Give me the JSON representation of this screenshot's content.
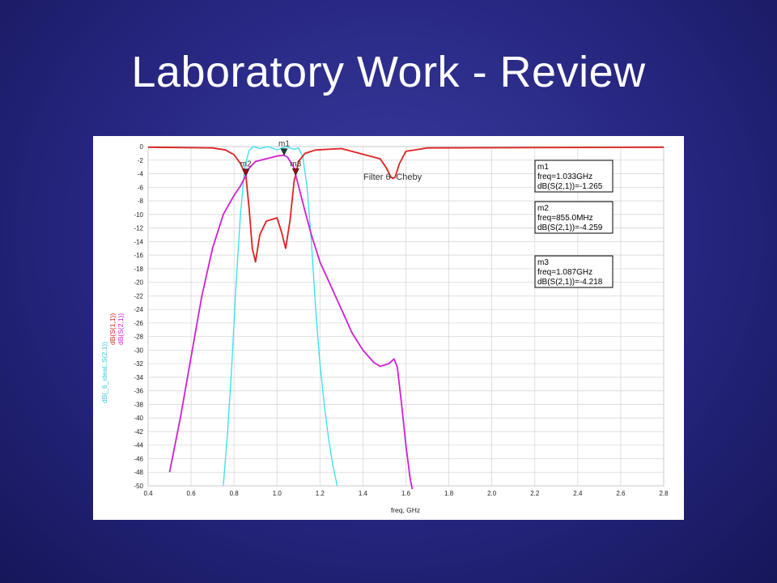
{
  "slide": {
    "title": "Laboratory Work - Review"
  },
  "chart_data": {
    "type": "line",
    "xlabel": "freq, GHz",
    "xlim": [
      0.4,
      2.8
    ],
    "ylim": [
      -50,
      0
    ],
    "xticks": [
      "0.4",
      "0.6",
      "0.8",
      "1.0",
      "1.2",
      "1.4",
      "1.6",
      "1.8",
      "2.0",
      "2.2",
      "2.4",
      "2.6",
      "2.8"
    ],
    "yticks": [
      "0",
      "-2",
      "-4",
      "-6",
      "-8",
      "-10",
      "-12",
      "-14",
      "-16",
      "-18",
      "-20",
      "-22",
      "-24",
      "-26",
      "-28",
      "-30",
      "-32",
      "-34",
      "-36",
      "-38",
      "-40",
      "-42",
      "-44",
      "-46",
      "-48",
      "-50"
    ],
    "annotation": "Filter 6- Cheby",
    "series": [
      {
        "name": "dB(_6_ideal..S(2,1))",
        "color": "#33e0f0",
        "x": [
          0.75,
          0.77,
          0.79,
          0.81,
          0.83,
          0.85,
          0.87,
          0.89,
          0.92,
          0.96,
          1.0,
          1.04,
          1.08,
          1.1,
          1.12,
          1.14,
          1.16,
          1.18,
          1.2,
          1.22,
          1.24,
          1.26,
          1.28
        ],
        "y": [
          -50,
          -42,
          -32,
          -20,
          -10,
          -3,
          -0.6,
          0,
          -0.3,
          0,
          -0.5,
          0,
          -0.4,
          -0.2,
          -1.5,
          -6,
          -14,
          -24,
          -32,
          -38,
          -43,
          -47,
          -50
        ]
      },
      {
        "name": "dB(S(1,1))",
        "color": "#e02020",
        "x": [
          0.4,
          0.7,
          0.76,
          0.8,
          0.83,
          0.855,
          0.87,
          0.885,
          0.9,
          0.92,
          0.95,
          1.0,
          1.02,
          1.04,
          1.06,
          1.08,
          1.087,
          1.1,
          1.13,
          1.18,
          1.3,
          1.48,
          1.51,
          1.53,
          1.54,
          1.55,
          1.57,
          1.6,
          1.7,
          2.8
        ],
        "y": [
          -0.1,
          -0.2,
          -0.5,
          -1.2,
          -2.5,
          -4.3,
          -9,
          -15,
          -17,
          -13,
          -11,
          -10.5,
          -12.5,
          -15,
          -11,
          -5,
          -4.2,
          -2.2,
          -1,
          -0.5,
          -0.3,
          -1.8,
          -3.2,
          -4.5,
          -4.7,
          -4.5,
          -2.5,
          -0.7,
          -0.2,
          -0.1
        ]
      },
      {
        "name": "dB(S(2,1))",
        "color": "#d020d0",
        "x": [
          0.5,
          0.55,
          0.6,
          0.65,
          0.7,
          0.75,
          0.8,
          0.83,
          0.855,
          0.87,
          0.9,
          0.95,
          1.0,
          1.033,
          1.05,
          1.08,
          1.087,
          1.1,
          1.13,
          1.16,
          1.2,
          1.25,
          1.3,
          1.35,
          1.4,
          1.45,
          1.48,
          1.52,
          1.545,
          1.56,
          1.58,
          1.6,
          1.62,
          1.64
        ],
        "y": [
          -48,
          -40,
          -31,
          -22,
          -15,
          -10,
          -7.2,
          -5.8,
          -4.26,
          -3.2,
          -2.2,
          -1.8,
          -1.4,
          -1.27,
          -1.6,
          -3.2,
          -4.22,
          -5.8,
          -9.5,
          -13,
          -17,
          -20.5,
          -24,
          -27.5,
          -30,
          -31.8,
          -32.4,
          -32,
          -31.3,
          -32.5,
          -38,
          -44,
          -49,
          -52
        ]
      }
    ],
    "markers": [
      {
        "name": "m1",
        "freq": "freq=1.033GHz",
        "value": "dB(S(2,1))=-1.265",
        "x": 1.033,
        "y": -1.265
      },
      {
        "name": "m2",
        "freq": "freq=855.0MHz",
        "value": "dB(S(2,1))=-4.259",
        "x": 0.855,
        "y": -4.259
      },
      {
        "name": "m3",
        "freq": "freq=1.087GHz",
        "value": "dB(S(2,1))=-4.218",
        "x": 1.087,
        "y": -4.218
      }
    ]
  }
}
